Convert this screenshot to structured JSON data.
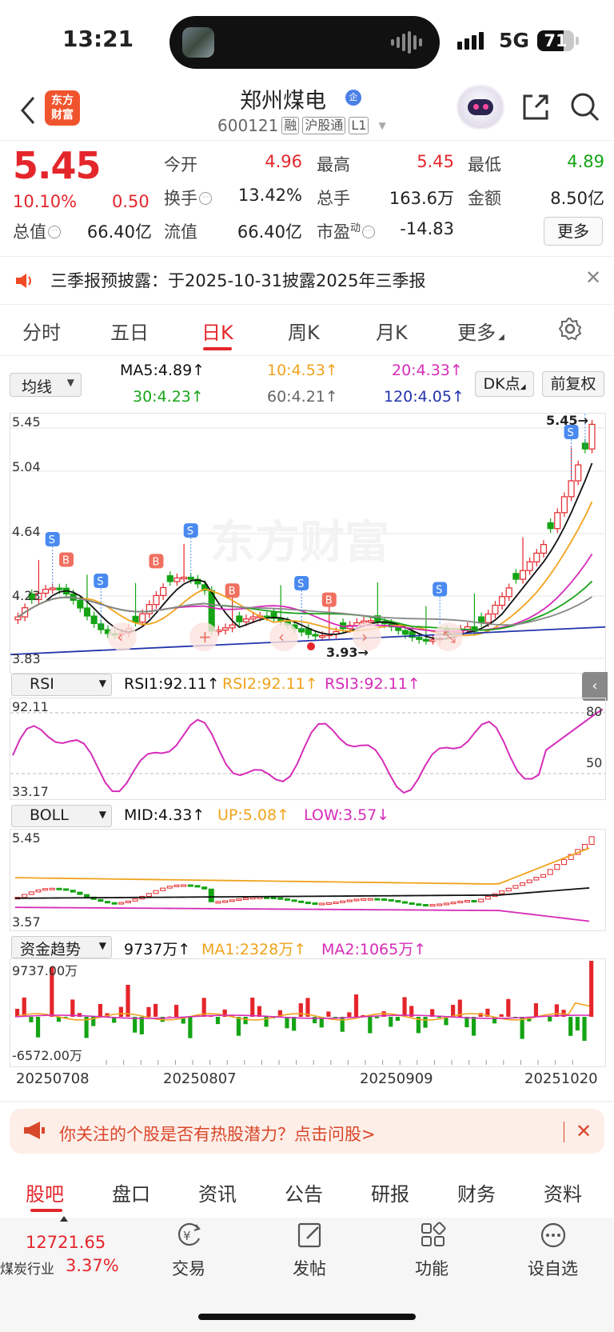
{
  "status_bar": {
    "time": "13:21",
    "network": "5G",
    "battery": "71",
    "battery_level": 0.71
  },
  "header": {
    "title": "郑州煤电",
    "title_badge": "企",
    "logo_text": "东方财富",
    "code": "600121",
    "tags": [
      "融",
      "沪股通",
      "L1"
    ]
  },
  "quote": {
    "price": "5.45",
    "change_pct": "10.10%",
    "change": "0.50",
    "stats": [
      {
        "label": "今开",
        "value": "4.96",
        "color": "red"
      },
      {
        "label": "最高",
        "value": "5.45",
        "color": "red"
      },
      {
        "label": "最低",
        "value": "4.89",
        "color": "green"
      },
      {
        "label": "换手",
        "value": "13.42%",
        "color": "black"
      },
      {
        "label": "总手",
        "value": "163.6万",
        "color": "black"
      },
      {
        "label": "金额",
        "value": "8.50亿",
        "color": "black"
      },
      {
        "label": "总值",
        "value": "66.40亿",
        "color": "black"
      },
      {
        "label": "流值",
        "value": "66.40亿",
        "color": "black"
      },
      {
        "label": "市盈",
        "value": "-14.83",
        "color": "black",
        "sup": "动"
      }
    ],
    "more_label": "更多"
  },
  "notice": {
    "text": "三季报预披露：于2025-10-31披露2025年三季报"
  },
  "tabs": [
    "分时",
    "五日",
    "日K",
    "周K",
    "月K",
    "更多"
  ],
  "active_tab": "日K",
  "ma_row": {
    "select_label": "均线",
    "ma5": "MA5:4.89",
    "ma10": "10:4.53",
    "ma20": "20:4.33",
    "ma30": "30:4.23",
    "ma60": "60:4.21",
    "ma120": "120:4.05",
    "dk_label": "DK点",
    "fuquan_label": "前复权"
  },
  "kline": {
    "y_labels": [
      "5.45",
      "5.04",
      "4.64",
      "4.23",
      "3.83"
    ],
    "high_marker": "5.45",
    "low_marker": "3.93",
    "watermark": "东方财富"
  },
  "rsi": {
    "select_label": "RSI",
    "rsi1": "RSI1:92.11",
    "rsi2": "RSI2:92.11",
    "rsi3": "RSI3:92.11",
    "y_top": "92.11",
    "y_bottom": "33.17",
    "level_80": "80",
    "level_50": "50"
  },
  "boll": {
    "select_label": "BOLL",
    "mid": "MID:4.33",
    "up": "UP:5.08",
    "low": "LOW:3.57",
    "y_top": "5.45",
    "y_bottom": "3.57"
  },
  "fund": {
    "select_label": "资金趋势",
    "value": "9737万",
    "ma1": "MA1:2328万",
    "ma2": "MA2:1065万",
    "y_top": "9737.00万",
    "y_bottom": "-6572.00万"
  },
  "x_labels": [
    "20250708",
    "20250807",
    "20250909",
    "20251020"
  ],
  "promo": {
    "text": "你关注的个股是否有热股潜力？点击问股>"
  },
  "bottom_tabs": [
    "股吧",
    "盘口",
    "资讯",
    "公告",
    "研报",
    "财务",
    "资料"
  ],
  "active_bottom_tab": "股吧",
  "bottom_bar": {
    "index_value": "12721.65",
    "index_name": "煤炭行业",
    "index_pct": "3.37%",
    "actions": [
      "交易",
      "发帖",
      "功能",
      "设自选"
    ]
  },
  "colors": {
    "up": "#e4262b",
    "down": "#14a414",
    "ma5": "#111111",
    "ma10": "#f0a31c",
    "ma20": "#d62cb8",
    "ma30": "#18a418",
    "ma60": "#888888",
    "ma120": "#2233aa"
  }
}
